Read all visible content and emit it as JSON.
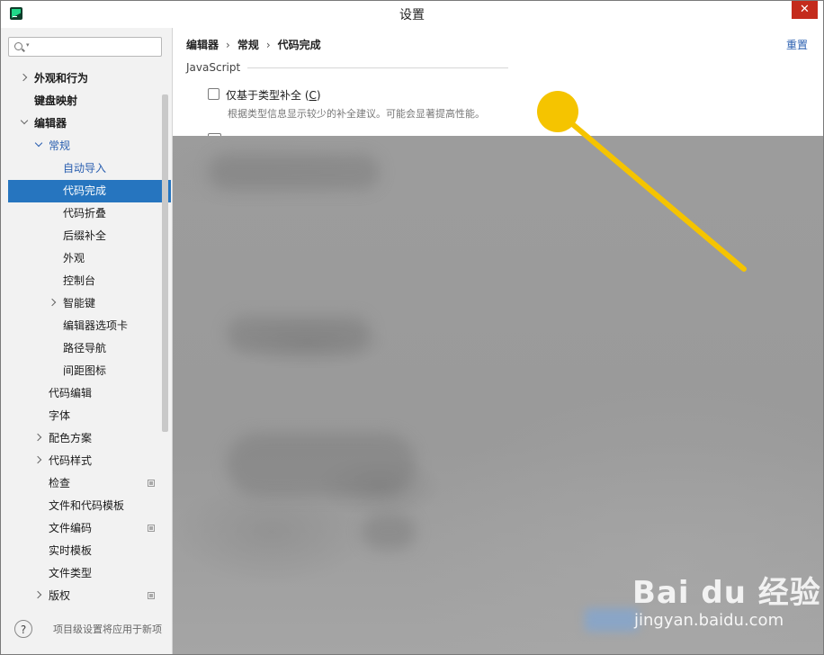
{
  "window": {
    "title": "设置",
    "close_glyph": "✕"
  },
  "sidebar": {
    "search_placeholder": "",
    "items": [
      {
        "label": "外观和行为",
        "arrow": "right"
      },
      {
        "label": "键盘映射"
      },
      {
        "label": "编辑器",
        "arrow": "down"
      },
      {
        "label": "常规",
        "arrow": "down"
      },
      {
        "label": "自动导入"
      },
      {
        "label": "代码完成",
        "selected": true
      },
      {
        "label": "代码折叠"
      },
      {
        "label": "后缀补全"
      },
      {
        "label": "外观"
      },
      {
        "label": "控制台"
      },
      {
        "label": "智能键",
        "arrow": "right"
      },
      {
        "label": "编辑器选项卡"
      },
      {
        "label": "路径导航"
      },
      {
        "label": "间距图标"
      },
      {
        "label": "代码编辑"
      },
      {
        "label": "字体"
      },
      {
        "label": "配色方案",
        "arrow": "right"
      },
      {
        "label": "代码样式",
        "arrow": "right"
      },
      {
        "label": "检查",
        "badge": true
      },
      {
        "label": "文件和代码模板"
      },
      {
        "label": "文件编码",
        "badge": true
      },
      {
        "label": "实时模板"
      },
      {
        "label": "文件类型"
      },
      {
        "label": "版权",
        "arrow": "right",
        "badge": true
      }
    ],
    "footer_text": "项目级设置将应用于新项"
  },
  "content": {
    "breadcrumb": [
      "编辑器",
      "常规",
      "代码完成"
    ],
    "breadcrumb_sep": "›",
    "reset_label": "重置",
    "section": "JavaScript",
    "option": {
      "label": "仅基于类型补全 (",
      "mnemonic": "C",
      "label_end": ")",
      "checked": false,
      "description": "根据类型信息显示较少的补全建议。可能会显著提高性能。"
    }
  },
  "annotation": {
    "color": "#f5c400"
  },
  "watermark": {
    "logo": "Bai  du 经验",
    "url": "jingyan.baidu.com"
  },
  "colors": {
    "selection": "#2675bf",
    "link": "#2a5fb0",
    "close": "#c42b1c"
  }
}
